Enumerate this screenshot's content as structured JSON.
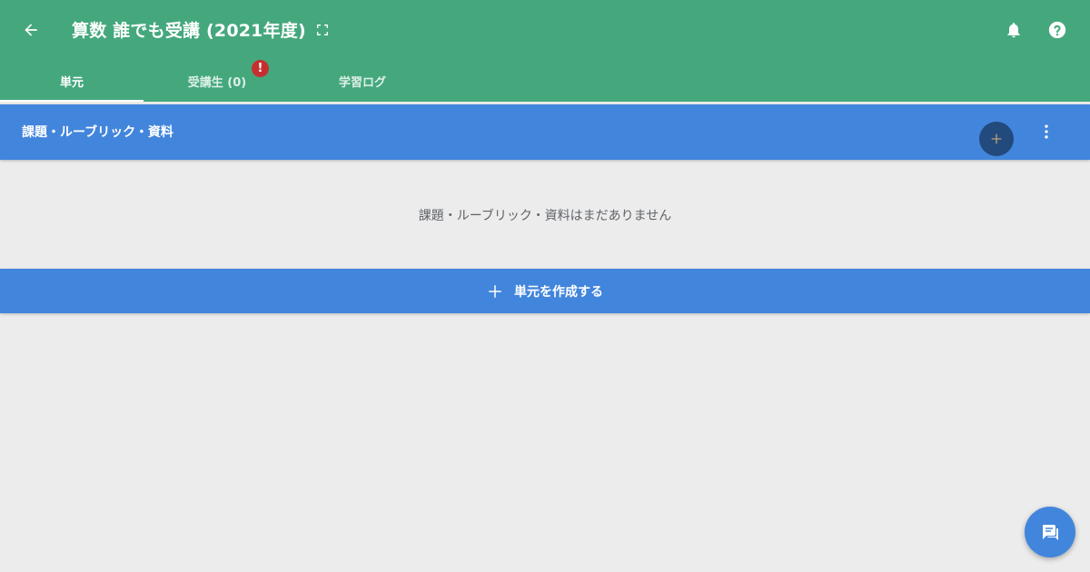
{
  "header": {
    "title": "算数 誰でも受講 (2021年度)",
    "background_color": "#45a87d",
    "icons": {
      "back": "arrow-left-icon",
      "fullscreen": "fullscreen-icon",
      "notifications": "bell-icon",
      "help": "help-circle-icon"
    }
  },
  "tabs": [
    {
      "label": "単元",
      "active": true
    },
    {
      "label": "受講生 (0)",
      "active": false,
      "badge": "!"
    },
    {
      "label": "学習ログ",
      "active": false
    }
  ],
  "section": {
    "title": "課題・ルーブリック・資料",
    "background_color": "#4285dc",
    "add_icon": "plus-icon",
    "more_icon": "dots-vertical-icon"
  },
  "empty_message": "課題・ルーブリック・資料はまだありません",
  "create_unit": {
    "icon": "plus-icon",
    "label": "単元を作成する"
  },
  "chat_fab": {
    "icon": "chat-icon"
  },
  "colors": {
    "accent_blue": "#4285dc",
    "header_green": "#45a87d",
    "alert_red": "#c62f2f",
    "page_background": "#ececec"
  }
}
